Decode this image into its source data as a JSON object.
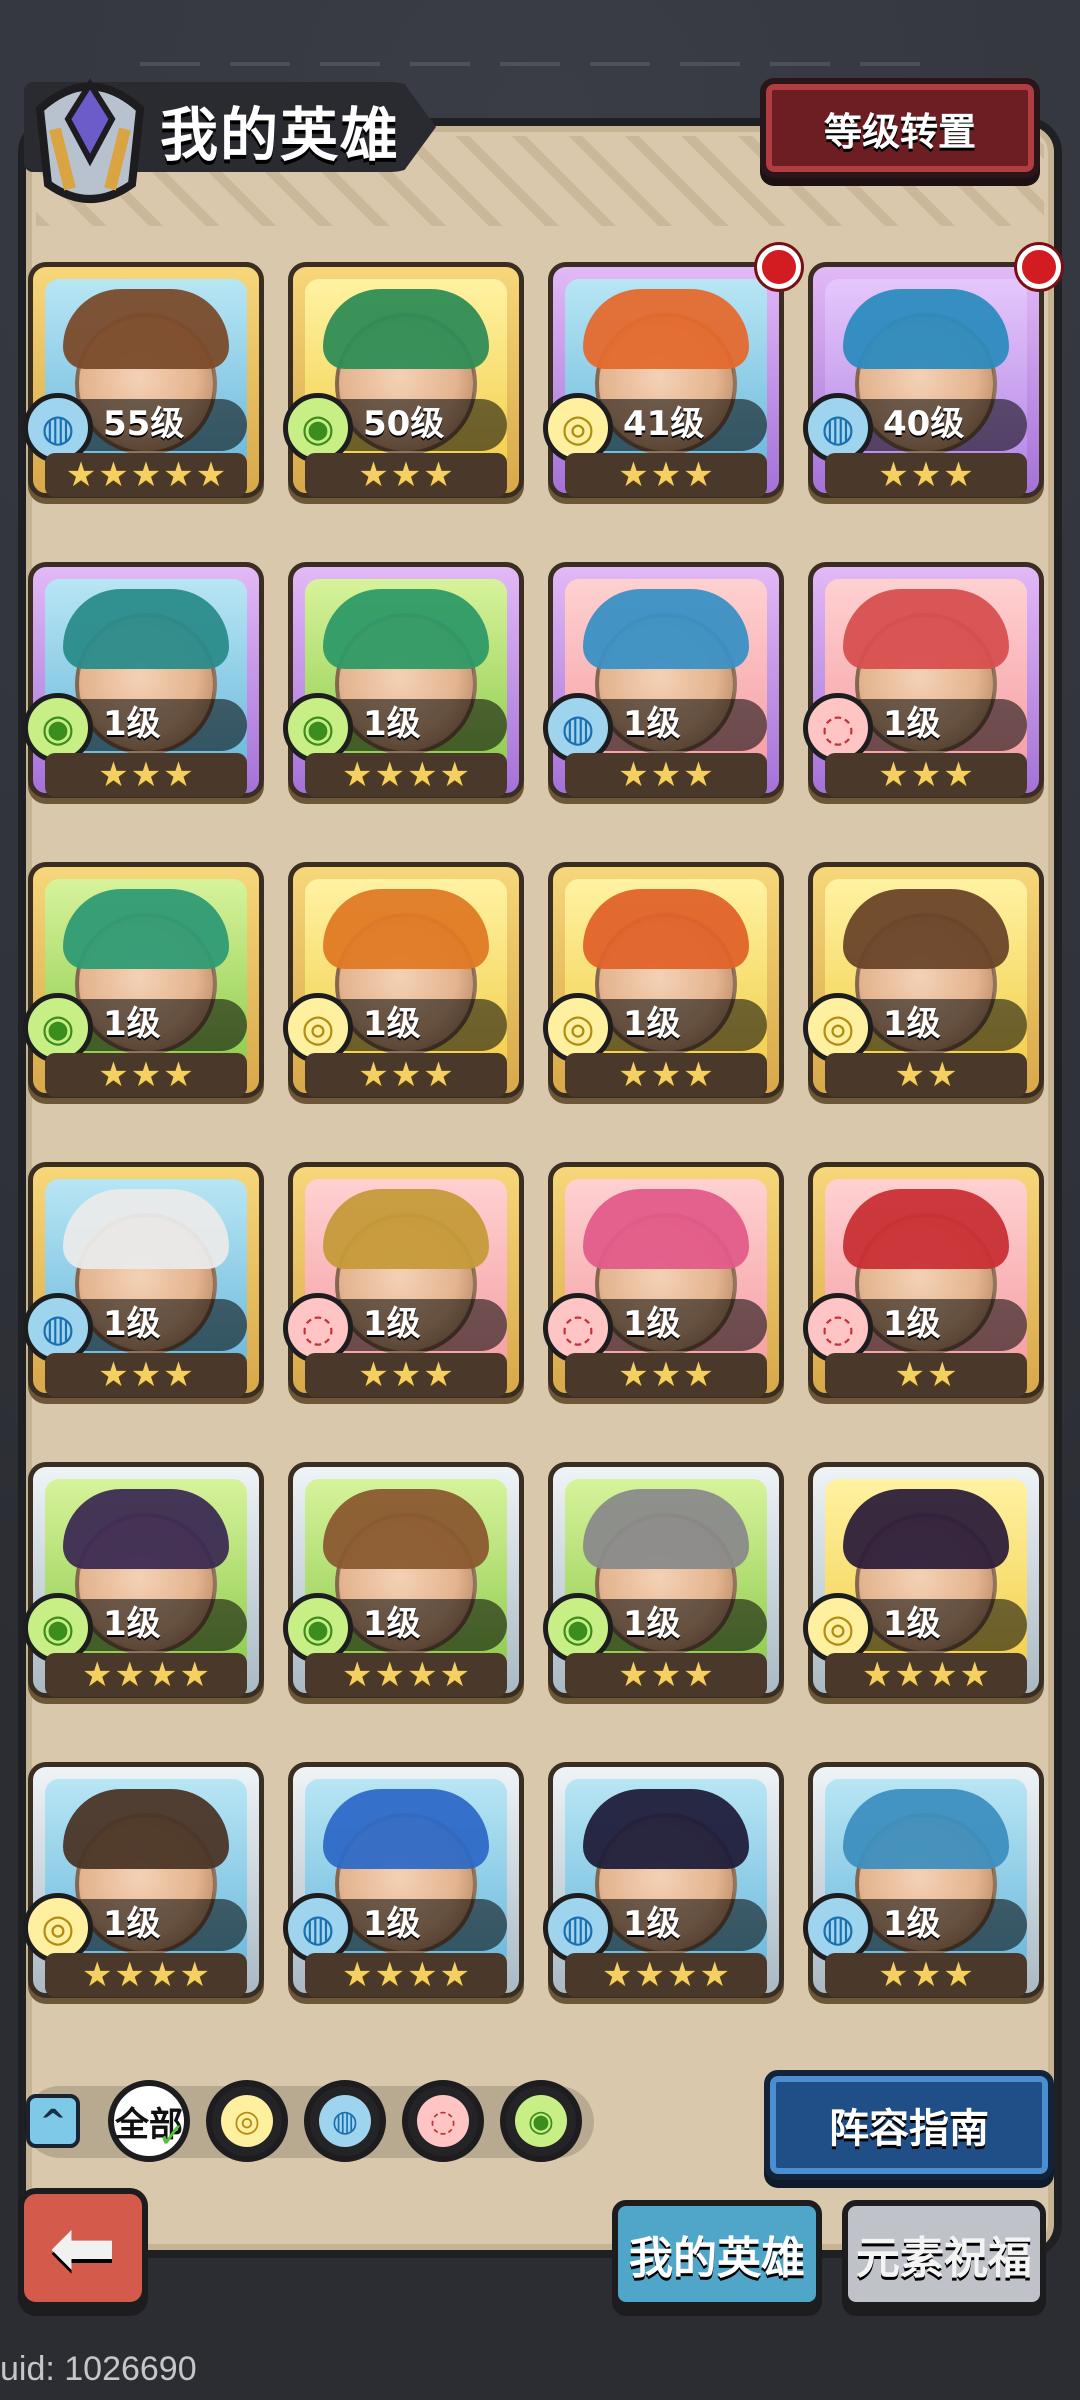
{
  "header": {
    "title": "我的英雄",
    "reset_button": "等级转置"
  },
  "heroes": [
    {
      "level": "55级",
      "element": "water",
      "stars": 5,
      "frame": "gold",
      "bg": "blue",
      "hair": "#7a4b2b",
      "notify": false
    },
    {
      "level": "50级",
      "element": "wind",
      "stars": 3,
      "frame": "gold",
      "bg": "yellow",
      "hair": "#2f8d55",
      "notify": false
    },
    {
      "level": "41级",
      "element": "earth",
      "stars": 3,
      "frame": "purple",
      "bg": "blue",
      "hair": "#e46a2d",
      "notify": true
    },
    {
      "level": "40级",
      "element": "water",
      "stars": 3,
      "frame": "purple",
      "bg": "purple",
      "hair": "#2c8bbf",
      "notify": true
    },
    {
      "level": "1级",
      "element": "wind",
      "stars": 3,
      "frame": "purple",
      "bg": "blue",
      "hair": "#2a8b8a",
      "notify": false
    },
    {
      "level": "1级",
      "element": "wind",
      "stars": 4,
      "frame": "purple",
      "bg": "green",
      "hair": "#2e9a66",
      "notify": false
    },
    {
      "level": "1级",
      "element": "water",
      "stars": 3,
      "frame": "purple",
      "bg": "pink",
      "hair": "#3a90c5",
      "notify": false
    },
    {
      "level": "1级",
      "element": "fire",
      "stars": 3,
      "frame": "purple",
      "bg": "pink",
      "hair": "#d84f4f",
      "notify": false
    },
    {
      "level": "1级",
      "element": "wind",
      "stars": 3,
      "frame": "gold",
      "bg": "green",
      "hair": "#2f9b74",
      "notify": false
    },
    {
      "level": "1级",
      "element": "earth",
      "stars": 3,
      "frame": "gold",
      "bg": "yellow",
      "hair": "#e07a25",
      "notify": false
    },
    {
      "level": "1级",
      "element": "earth",
      "stars": 3,
      "frame": "gold",
      "bg": "yellow",
      "hair": "#e0632a",
      "notify": false
    },
    {
      "level": "1级",
      "element": "earth",
      "stars": 2,
      "frame": "gold",
      "bg": "yellow",
      "hair": "#6a4429",
      "notify": false
    },
    {
      "level": "1级",
      "element": "water",
      "stars": 3,
      "frame": "gold",
      "bg": "blue",
      "hair": "#eaeaea",
      "notify": false
    },
    {
      "level": "1级",
      "element": "fire",
      "stars": 3,
      "frame": "gold",
      "bg": "pink",
      "hair": "#c69a3a",
      "notify": false
    },
    {
      "level": "1级",
      "element": "fire",
      "stars": 3,
      "frame": "gold",
      "bg": "pink",
      "hair": "#e35b8a",
      "notify": false
    },
    {
      "level": "1级",
      "element": "fire",
      "stars": 2,
      "frame": "gold",
      "bg": "pink",
      "hair": "#c92f35",
      "notify": false
    },
    {
      "level": "1级",
      "element": "wind",
      "stars": 4,
      "frame": "silver",
      "bg": "green",
      "hair": "#3c2b52",
      "notify": false
    },
    {
      "level": "1级",
      "element": "wind",
      "stars": 4,
      "frame": "silver",
      "bg": "green",
      "hair": "#8a5a2f",
      "notify": false
    },
    {
      "level": "1级",
      "element": "wind",
      "stars": 3,
      "frame": "silver",
      "bg": "green",
      "hair": "#8a8a8a",
      "notify": false
    },
    {
      "level": "1级",
      "element": "earth",
      "stars": 4,
      "frame": "silver",
      "bg": "yellow",
      "hair": "#2d1f3a",
      "notify": false
    },
    {
      "level": "1级",
      "element": "earth",
      "stars": 4,
      "frame": "silver",
      "bg": "blue",
      "hair": "#4a3526",
      "notify": false
    },
    {
      "level": "1级",
      "element": "water",
      "stars": 4,
      "frame": "silver",
      "bg": "blue",
      "hair": "#2e6ac7",
      "notify": false
    },
    {
      "level": "1级",
      "element": "water",
      "stars": 4,
      "frame": "silver",
      "bg": "blue",
      "hair": "#1f1e3a",
      "notify": false
    },
    {
      "level": "1级",
      "element": "water",
      "stars": 3,
      "frame": "silver",
      "bg": "blue",
      "hair": "#3d8fbf",
      "notify": false
    }
  ],
  "filters": {
    "all_label": "全部",
    "icons": [
      "earth",
      "water",
      "fire",
      "wind"
    ]
  },
  "buttons": {
    "lineup_guide": "阵容指南"
  },
  "tabs": {
    "my_heroes": "我的英雄",
    "element_blessing": "元素祝福"
  },
  "footer": {
    "uid": "uid: 1026690"
  },
  "colors": {
    "water": "#1a6fb0",
    "wind": "#3b8d1e",
    "earth": "#b28c12",
    "fire": "#c42e35"
  }
}
